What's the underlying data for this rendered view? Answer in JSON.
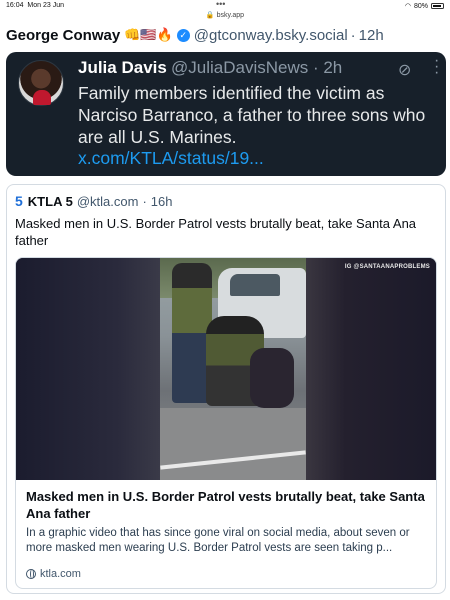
{
  "status_bar": {
    "time": "16:04",
    "date": "Mon 23 Jun",
    "dots": "•••",
    "wifi_icon": "wifi-icon",
    "battery": "80%",
    "url": "bsky.app"
  },
  "post": {
    "author": "George Conway",
    "emojis": "👊🇺🇸🔥",
    "handle": "@gtconway.bsky.social",
    "separator": "·",
    "time_ago": "12h"
  },
  "embedded_tweet": {
    "name": "Julia Davis",
    "handle_time": "@JuliaDavisNews · 2h",
    "text": "Family members identified the victim as Narciso Barranco, a father to three sons who are all U.S. Marines.",
    "link": "x.com/KTLA/status/19..."
  },
  "quote": {
    "logo": "5",
    "name": "KTLA 5",
    "handle": "@ktla.com",
    "separator": "·",
    "time_ago": "16h",
    "text": "Masked men in U.S. Border Patrol vests brutally beat, take Santa Ana father"
  },
  "link_card": {
    "watermark": "IG @SANTAANAPROBLEMS",
    "title": "Masked men in U.S. Border Patrol vests brutally beat, take Santa Ana father",
    "description": "In a graphic video that has since gone viral on social media, about seven or more masked men wearing U.S. Border Patrol vests are seen taking p...",
    "domain": "ktla.com"
  }
}
